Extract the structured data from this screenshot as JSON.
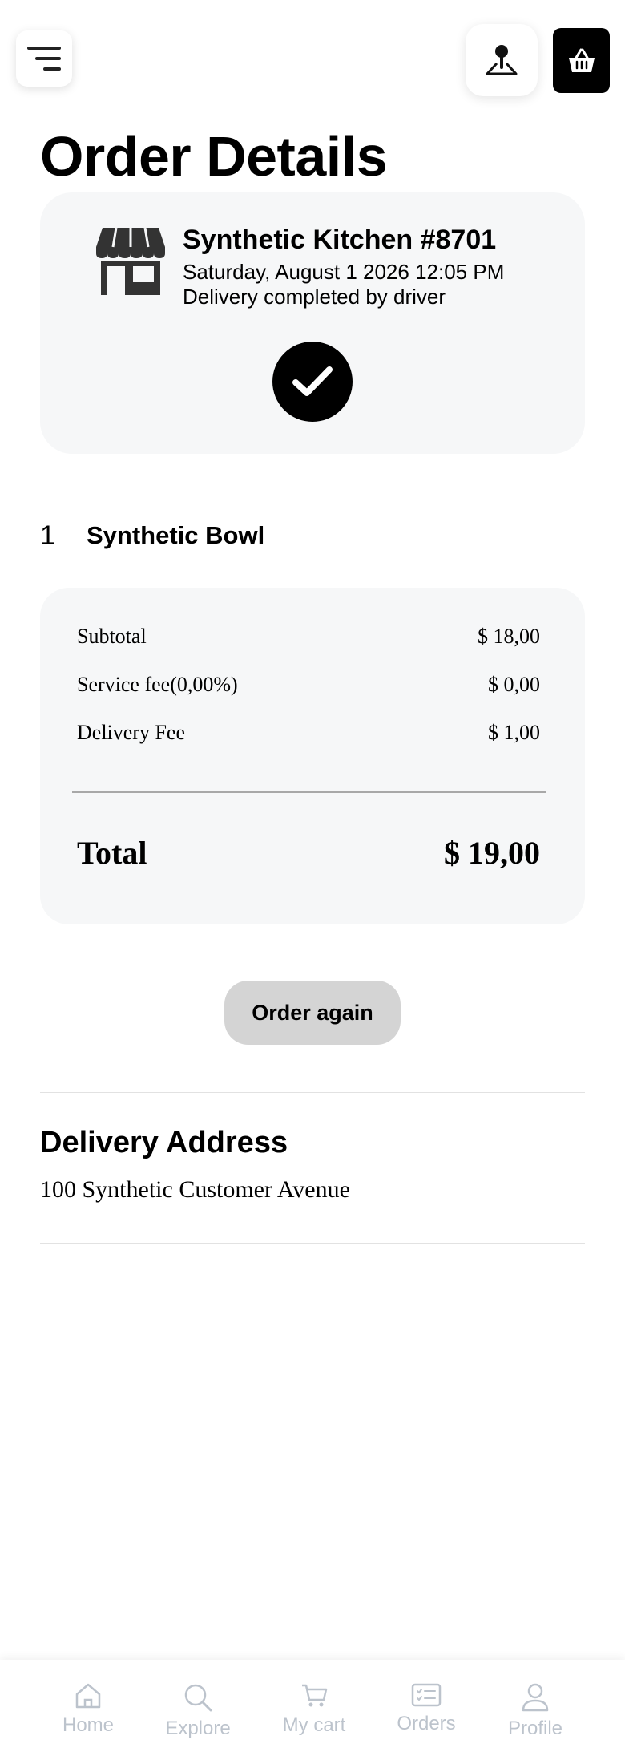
{
  "header": {
    "menu_icon": "menu-icon",
    "location_icon": "location-pin-icon",
    "cart_icon": "basket-icon",
    "title": "Order Details"
  },
  "store": {
    "icon": "store-icon",
    "name": "Synthetic Kitchen #8701",
    "date": "Saturday, August 1 2026 12:05 PM",
    "status": "Delivery completed by driver",
    "status_icon": "check-circle-icon"
  },
  "items": [
    {
      "qty": "1",
      "name": "Synthetic Bowl"
    }
  ],
  "summary": {
    "subtotal_label": "Subtotal",
    "subtotal_value": "$ 18,00",
    "service_label": "Service fee(0,00%)",
    "service_value": "$ 0,00",
    "delivery_label": "Delivery Fee",
    "delivery_value": "$ 1,00",
    "total_label": "Total",
    "total_value": "$ 19,00"
  },
  "actions": {
    "order_again_label": "Order again"
  },
  "address": {
    "title": "Delivery Address",
    "line": "100 Synthetic Customer Avenue"
  },
  "nav": {
    "items": [
      {
        "label": "Home",
        "icon": "home-icon"
      },
      {
        "label": "Explore",
        "icon": "search-icon"
      },
      {
        "label": "My cart",
        "icon": "cart-icon"
      },
      {
        "label": "Orders",
        "icon": "orders-icon"
      },
      {
        "label": "Profile",
        "icon": "user-icon"
      }
    ]
  },
  "colors": {
    "card_bg": "#f6f7f8",
    "button_bg": "#d4d4d4",
    "nav_inactive": "#bcc3cc",
    "primary": "#000000"
  }
}
